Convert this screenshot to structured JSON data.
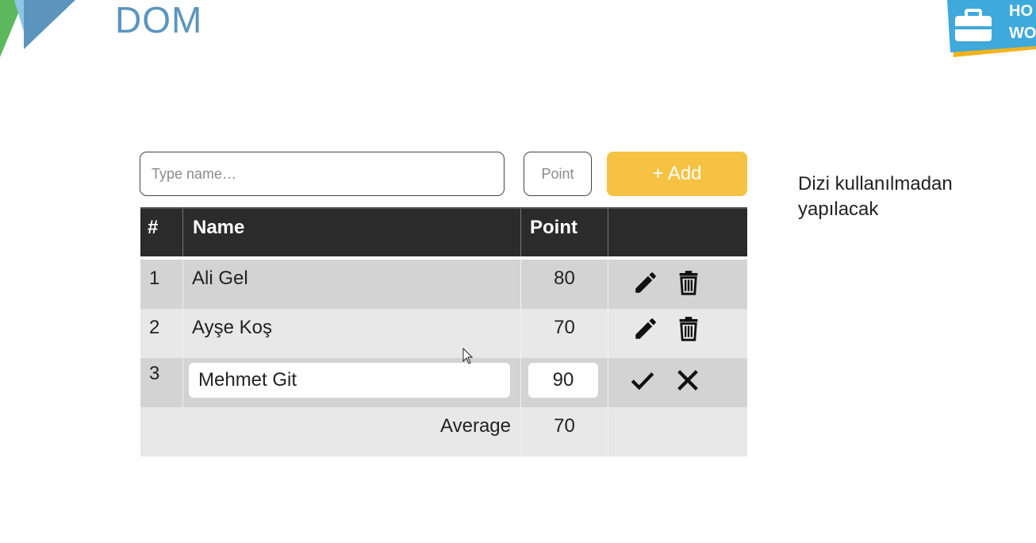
{
  "slide": {
    "title": "DOM",
    "badge": {
      "line1": "HO",
      "line2": "WO"
    },
    "note": {
      "line1": "Dizi kullanılmadan",
      "line2": "yapılacak"
    }
  },
  "form": {
    "name_placeholder": "Type name…",
    "point_placeholder": "Point",
    "add_label": "+ Add"
  },
  "table": {
    "headers": {
      "index": "#",
      "name": "Name",
      "point": "Point",
      "actions": ""
    },
    "rows": [
      {
        "index": "1",
        "name": "Ali Gel",
        "point": "80",
        "actions": [
          "pencil-icon",
          "trash-icon"
        ]
      },
      {
        "index": "2",
        "name": "Ayşe Koş",
        "point": "70",
        "actions": [
          "pencil-icon",
          "trash-icon"
        ]
      },
      {
        "index": "3",
        "name": "Mehmet Git",
        "point": "90",
        "actions": [
          "check-icon",
          "close-icon"
        ],
        "editing": true
      }
    ],
    "average": {
      "label": "Average",
      "value": "70"
    }
  },
  "colors": {
    "title": "#5b95be",
    "add_button": "#f5c243",
    "header_bg": "#2b2b2b",
    "row_dark": "#d3d3d3",
    "row_light": "#e8e8e8",
    "badge": "#3fa9dc"
  }
}
